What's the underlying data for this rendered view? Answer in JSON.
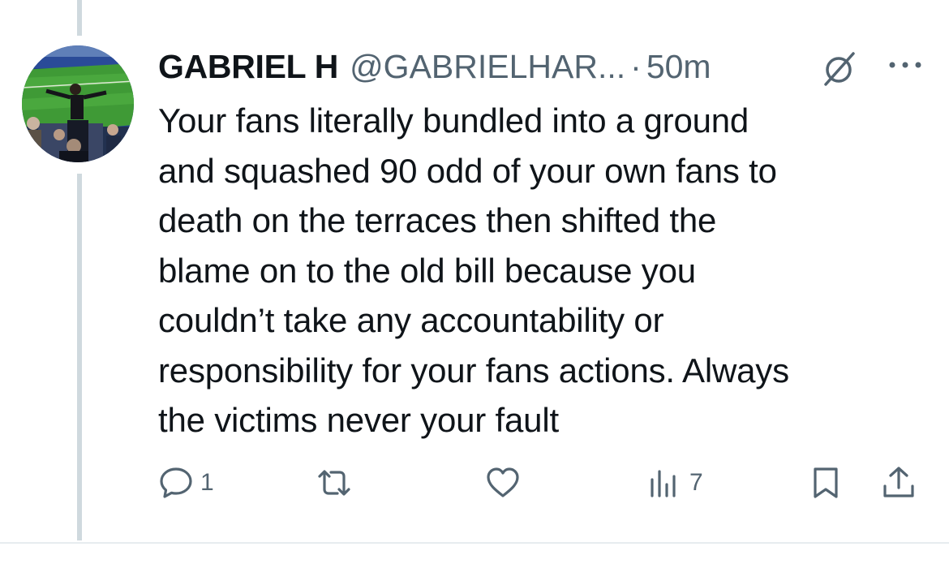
{
  "tweet": {
    "display_name": "GABRIEL H",
    "handle": "@GABRIELHAR...",
    "separator": "·",
    "time": "50m",
    "text": "Your fans literally bundled into a ground\nand squashed 90 odd of your own fans to\ndeath on the terraces then shifted the\nblame on to the old bill because you\ncouldn’t take any accountability or\nresponsibility for your fans actions. Always\nthe victims never your fault"
  },
  "actions": {
    "reply_count": "1",
    "views_count": "7"
  },
  "icons": {
    "avatar": "avatar-stadium-photo",
    "grok": "grok-icon",
    "more": "more-icon",
    "reply": "reply-icon",
    "retweet": "retweet-icon",
    "like": "heart-icon",
    "views": "views-chart-icon",
    "bookmark": "bookmark-icon",
    "share": "share-icon"
  },
  "colors": {
    "text_primary": "#0f1419",
    "text_secondary": "#536471",
    "thread_line": "#cfd9de"
  }
}
